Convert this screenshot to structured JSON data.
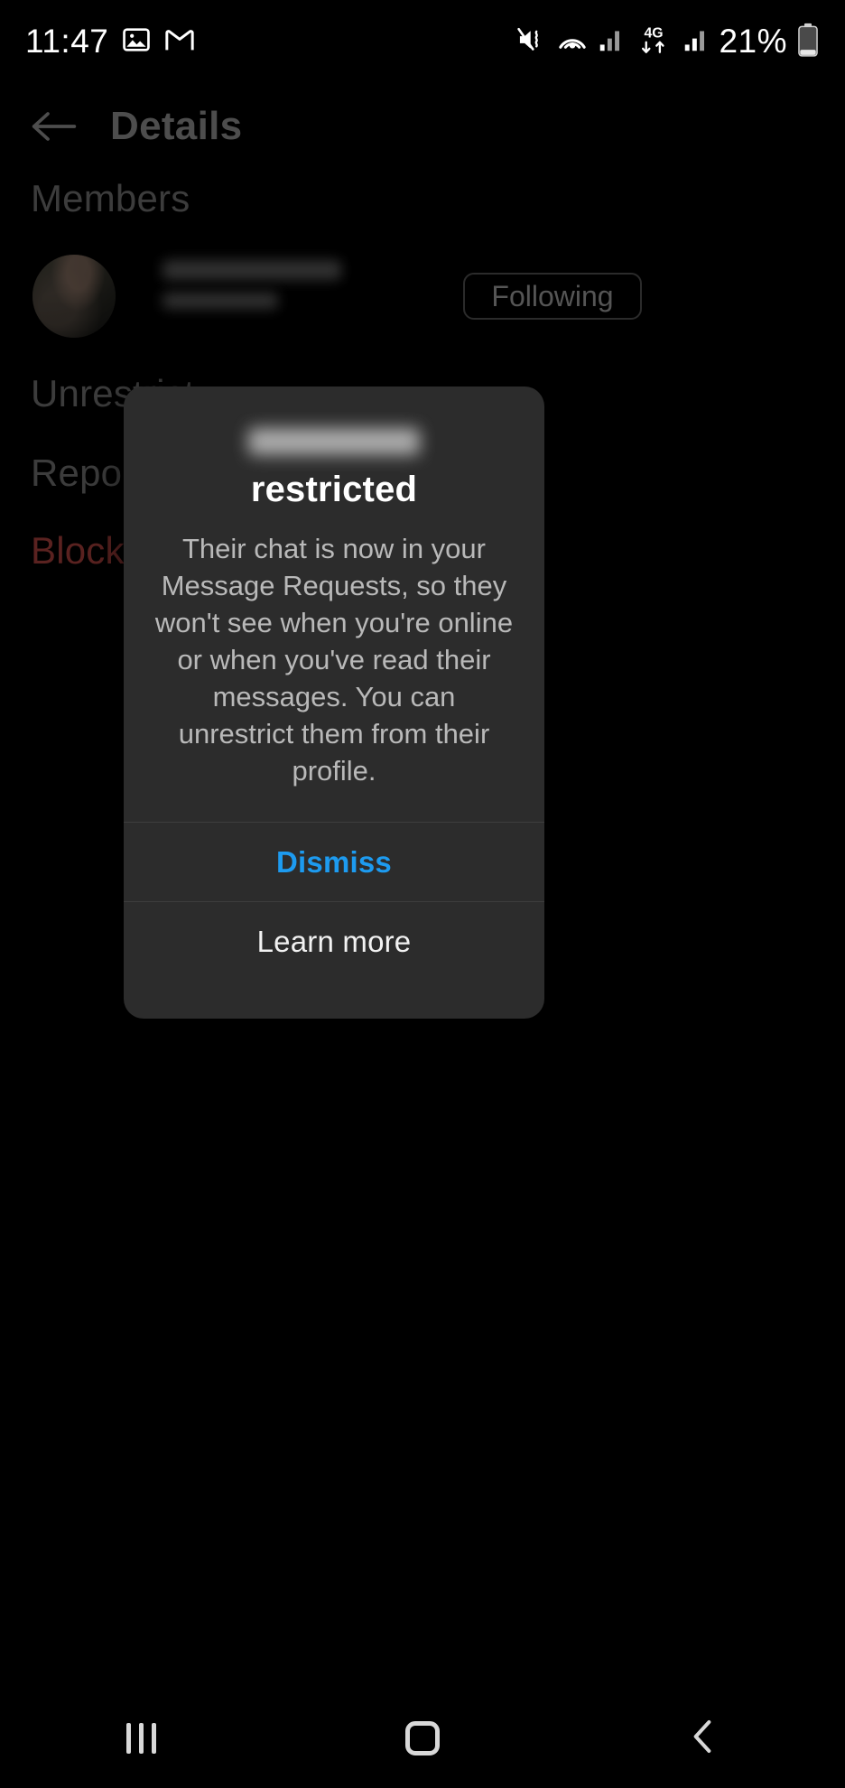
{
  "status_bar": {
    "time": "11:47",
    "battery_percent": "21%",
    "network_label": "4G",
    "icons": [
      "gallery-icon",
      "gmail-icon",
      "mute-vibrate-icon",
      "hotspot-icon",
      "signal-icon",
      "data-transfer-icon",
      "signal-icon-2",
      "battery-icon"
    ]
  },
  "header": {
    "back_label": "Back",
    "title": "Details"
  },
  "members": {
    "section_label": "Members",
    "member": {
      "name": "",
      "username": "",
      "follow_button": "Following"
    }
  },
  "menu": {
    "items": [
      {
        "label": "Unrestrict",
        "style": "normal"
      },
      {
        "label": "Report",
        "style": "normal"
      },
      {
        "label": "Block",
        "style": "danger"
      }
    ]
  },
  "dialog": {
    "username": "",
    "title": "restricted",
    "message": "Their chat is now in your Message Requests, so they won't see when you're online or when you've read their messages. You can unrestrict them from their profile.",
    "dismiss_label": "Dismiss",
    "learn_more_label": "Learn more",
    "accent_color": "#1d9bf0",
    "surface_color": "#2c2c2c"
  },
  "nav_bar": {
    "recents_label": "Recents",
    "home_label": "Home",
    "back_label": "Back"
  }
}
